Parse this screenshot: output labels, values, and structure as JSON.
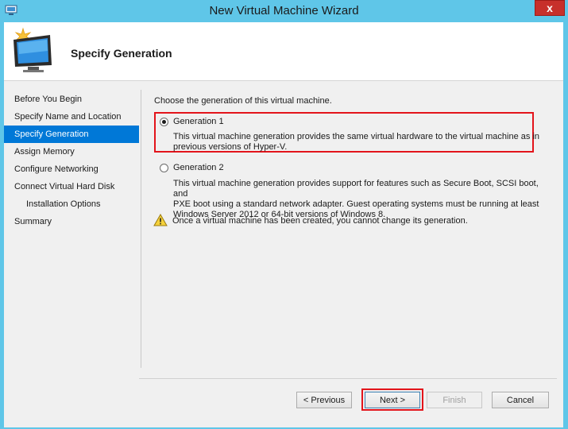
{
  "window": {
    "title": "New Virtual Machine Wizard",
    "close_glyph": "x"
  },
  "header": {
    "page_title": "Specify Generation",
    "icon": "wizard-monitor-icon"
  },
  "nav": {
    "items": [
      {
        "label": "Before You Begin"
      },
      {
        "label": "Specify Name and Location"
      },
      {
        "label": "Specify Generation",
        "active": true
      },
      {
        "label": "Assign Memory"
      },
      {
        "label": "Configure Networking"
      },
      {
        "label": "Connect Virtual Hard Disk"
      },
      {
        "label": "Installation Options",
        "sub": true
      },
      {
        "label": "Summary"
      }
    ]
  },
  "content": {
    "prompt": "Choose the generation of this virtual machine.",
    "generation1": {
      "label": "Generation 1",
      "selected": true,
      "desc_line1": "This virtual machine generation provides the same virtual hardware to the virtual machine as in",
      "desc_line2": "previous versions of Hyper-V."
    },
    "generation2": {
      "label": "Generation 2",
      "selected": false,
      "desc_line1": "This virtual machine generation provides support for features such as Secure Boot, SCSI boot, and",
      "desc_line2": "PXE boot using a standard network adapter. Guest operating systems must be running at least",
      "desc_line3": "Windows Server 2012 or 64-bit versions of Windows 8."
    },
    "warning": {
      "icon": "warning-icon",
      "text": "Once a virtual machine has been created, you cannot change its generation."
    }
  },
  "buttons": {
    "previous": "< Previous",
    "next": "Next >",
    "finish": "Finish",
    "cancel": "Cancel"
  },
  "colors": {
    "titlebar": "#5fc6e8",
    "nav_active": "#0078d7",
    "highlight": "#e3141b"
  }
}
